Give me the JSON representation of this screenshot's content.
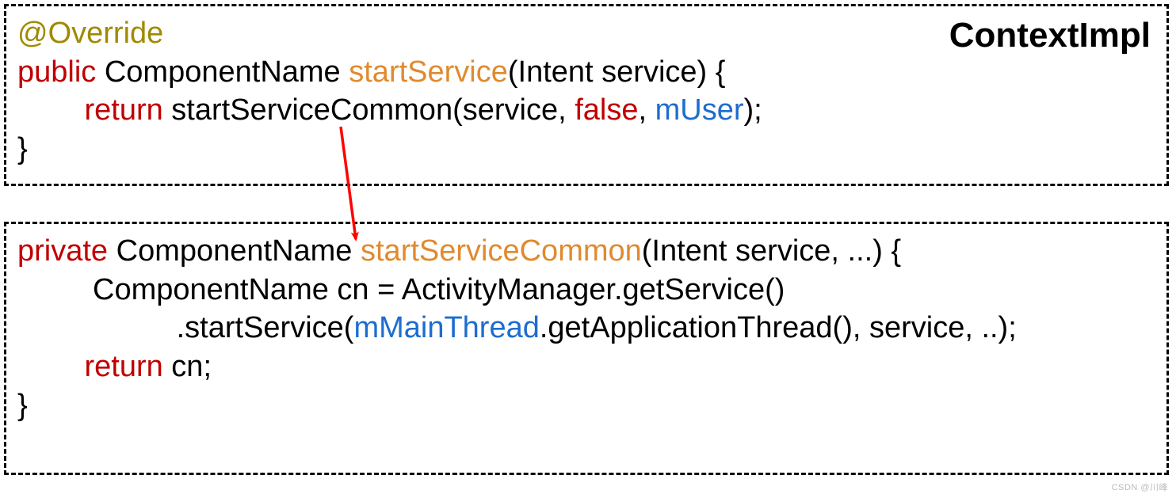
{
  "colors": {
    "annotation": "#A08A00",
    "keyword": "#C00000",
    "method": "#E08A2E",
    "field": "#1C6DD0",
    "text": "#000000",
    "border": "#000000",
    "arrow": "#FF0000"
  },
  "className": "ContextImpl",
  "method1": {
    "annotation": "@Override",
    "access": "public",
    "returnType": "ComponentName",
    "name": "startService",
    "params": "(Intent service) {",
    "bodyIndent": "        ",
    "returnKw": "return",
    "callName": " startServiceCommon(service, ",
    "falseKw": "false",
    "comma": ", ",
    "field": "mUser",
    "tail": ");",
    "close": "}"
  },
  "method2": {
    "access": "private",
    "returnType": " ComponentName ",
    "name": "startServiceCommon",
    "params": "(Intent service, ...) {",
    "line2Indent": "         ",
    "line2": "ComponentName cn = ActivityManager.getService()",
    "line3Indent": "                   ",
    "line3a": ".startService(",
    "line3Field": "mMainThread",
    "line3b": ".getApplicationThread(), service, ..);",
    "line4Indent": "        ",
    "returnKw": "return",
    "line4b": " cn;",
    "close": "}"
  },
  "watermark": "CSDN @川峰"
}
